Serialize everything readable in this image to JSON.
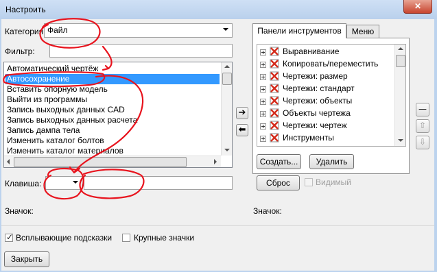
{
  "window": {
    "title": "Настроить",
    "close": "✕"
  },
  "left": {
    "category_label": "Категория:",
    "category_value": "Файл",
    "filter_label": "Фильтр:",
    "filter_value": "",
    "commands": [
      "Автоматический чертёж",
      "Автосохранение",
      "Вставить опорную модель",
      "Выйти из программы",
      "Запись выходных данных CAD",
      "Запись выходных данных расчета",
      "Запись дампа тела",
      "Изменить каталог болтов",
      "Изменить каталог материалов"
    ],
    "selected_index": 1,
    "key_label": "Клавиша:",
    "icon_label": "Значок:"
  },
  "transfer": {
    "add": "➔",
    "remove": "⬅"
  },
  "right": {
    "tabs": [
      "Панели инструментов",
      "Меню"
    ],
    "active_tab": 0,
    "toolbars": [
      "Выравнивание",
      "Копировать/переместить",
      "Чертежи: размер",
      "Чертежи: стандарт",
      "Чертежи: объекты",
      "Объекты чертежа",
      "Чертежи: чертеж",
      "Инструменты"
    ],
    "create_label": "Создать...",
    "delete_label": "Удалить",
    "reset_label": "Сброс",
    "visible_label": "Видимый",
    "icon_label": "Значок:",
    "side_buttons": {
      "remove": "—",
      "up": "⇧",
      "down": "⇩"
    }
  },
  "options": {
    "tooltips_label": "Всплывающие подсказки",
    "tooltips_checked": true,
    "large_icons_label": "Крупные значки",
    "large_icons_checked": false
  },
  "footer": {
    "close_label": "Закрыть"
  },
  "colors": {
    "selection": "#3399ff",
    "annotation": "#e8141e",
    "icon_red": "#d42a1a"
  }
}
